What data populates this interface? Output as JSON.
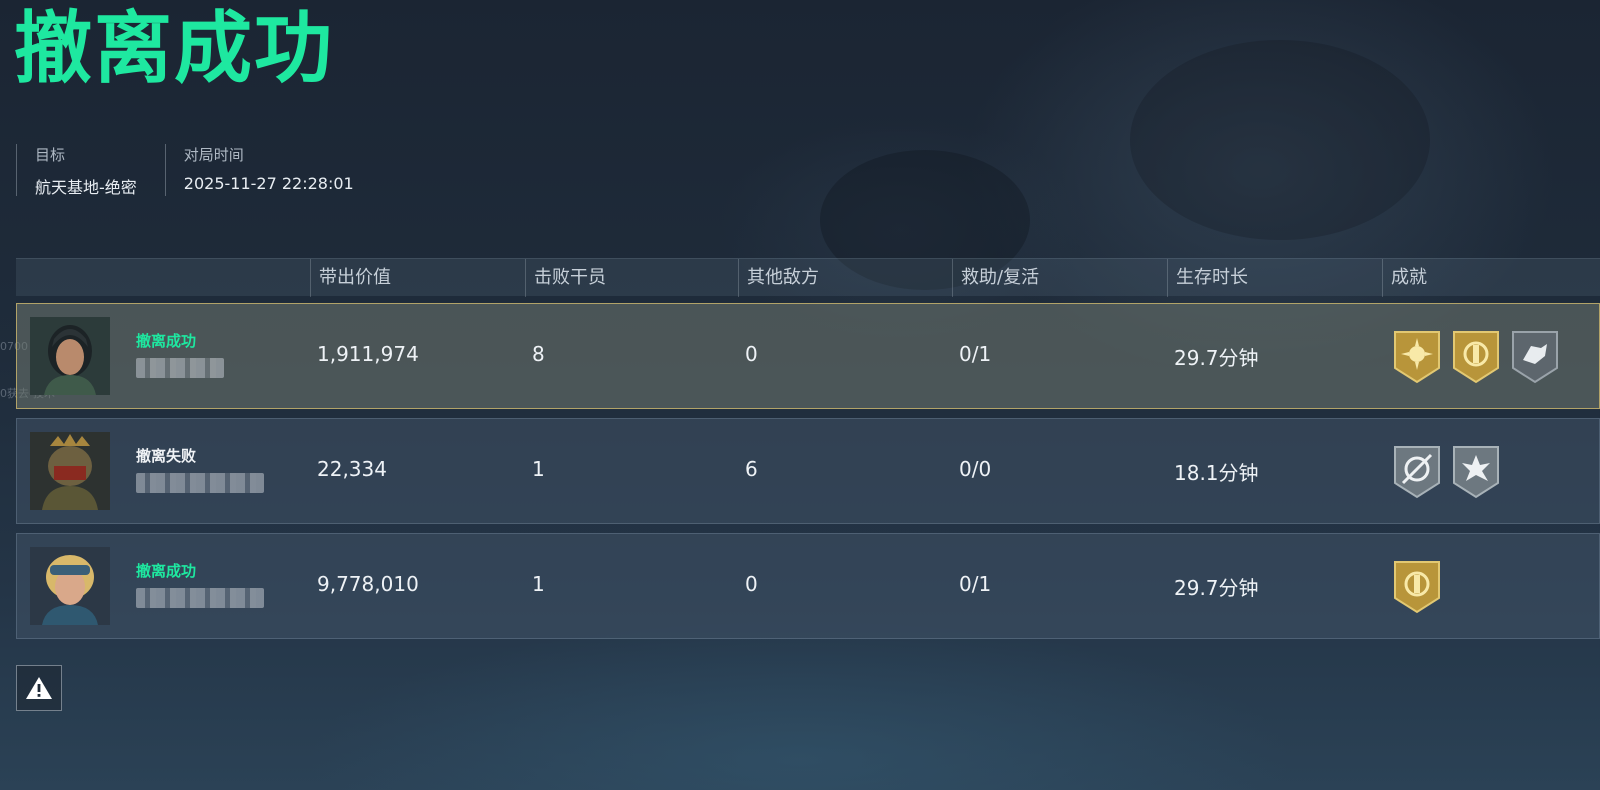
{
  "result_title": "撤离成功",
  "meta": {
    "target_label": "目标",
    "target_value": "航天基地-绝密",
    "time_label": "对局时间",
    "time_value": "2025-11-27 22:28:01"
  },
  "columns": [
    "带出价值",
    "击败干员",
    "其他敌方",
    "救助/复活",
    "生存时长",
    "成就"
  ],
  "rows": [
    {
      "status": "撤离成功",
      "status_type": "ok",
      "value": "1,911,974",
      "kills": "8",
      "other_enemies": "0",
      "assist": "0/1",
      "survival": "29.7分钟",
      "achievements": [
        "gold-sun-badge-icon",
        "gold-emblem-badge-icon",
        "gray-beast-badge-icon"
      ]
    },
    {
      "status": "撤离失败",
      "status_type": "fail",
      "value": "22,334",
      "kills": "1",
      "other_enemies": "6",
      "assist": "0/0",
      "survival": "18.1分钟",
      "achievements": [
        "gray-crosshair-badge-icon",
        "gray-burst-badge-icon"
      ]
    },
    {
      "status": "撤离成功",
      "status_type": "ok",
      "value": "9,778,010",
      "kills": "1",
      "other_enemies": "0",
      "assist": "0/1",
      "survival": "29.7分钟",
      "achievements": [
        "gold-emblem-badge-icon"
      ]
    }
  ],
  "colors": {
    "success": "#1ee8a0",
    "gold_badge": "#b8953a",
    "gray_badge": "#6d7880",
    "highlight_border": "#d4be6e"
  },
  "icons": {
    "report": "warning-triangle-icon"
  },
  "side_text": [
    "0700",
    "0获去-技术"
  ]
}
